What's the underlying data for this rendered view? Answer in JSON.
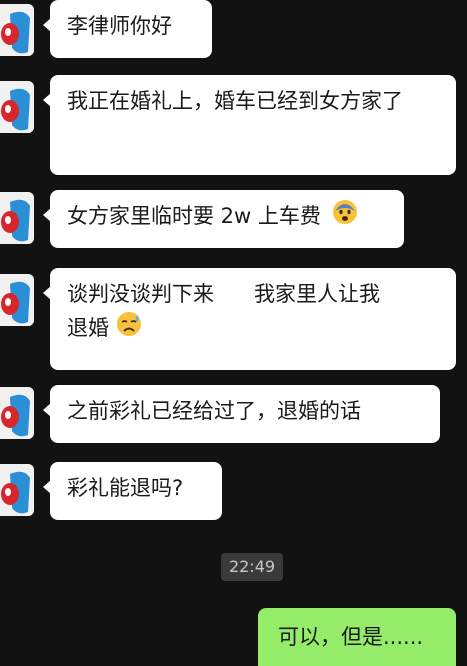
{
  "messages": [
    {
      "text": "李律师你好"
    },
    {
      "text": "我正在婚礼上，婚车已经到女方家了"
    },
    {
      "text": "女方家里临时要 2w 上车费",
      "emoji": "fearful-face"
    },
    {
      "text_line1": "谈判没谈判下来      我家里人让我",
      "text_line2": "退婚",
      "emoji": "sad-sweat-face"
    },
    {
      "text": "之前彩礼已经给过了，退婚的话"
    },
    {
      "text": "彩礼能退吗?"
    }
  ],
  "timestamp": "22:49",
  "outgoing": {
    "text": "可以，但是......"
  },
  "colors": {
    "background": "#121212",
    "incoming_bubble": "#ffffff",
    "outgoing_bubble": "#95ec69",
    "timestamp_bg": "#3a3a3a"
  }
}
